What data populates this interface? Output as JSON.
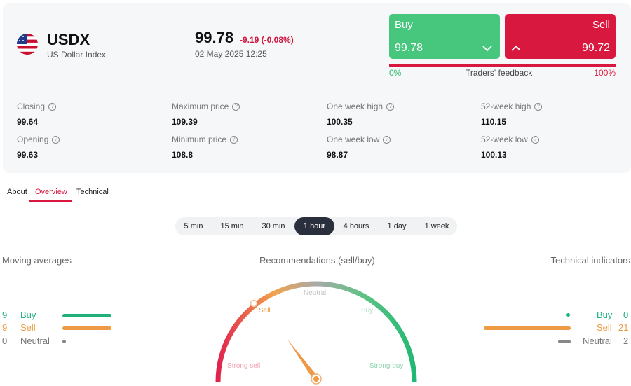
{
  "instrument": {
    "symbol": "USDX",
    "name": "US Dollar Index",
    "price": "99.78",
    "change": "-9.19 (-0.08%)",
    "datetime": "02 May 2025 12:25"
  },
  "trade": {
    "buy_label": "Buy",
    "buy_price": "99.78",
    "sell_label": "Sell",
    "sell_price": "99.72",
    "feedback_label": "Traders' feedback",
    "feedback_min": "0%",
    "feedback_max": "100%",
    "buy_share": 0.0
  },
  "stats": [
    {
      "label": "Closing",
      "value": "99.64"
    },
    {
      "label": "Maximum price",
      "value": "109.39"
    },
    {
      "label": "One week high",
      "value": "100.35"
    },
    {
      "label": "52-week high",
      "value": "110.15"
    },
    {
      "label": "Opening",
      "value": "99.63"
    },
    {
      "label": "Minimum price",
      "value": "108.8"
    },
    {
      "label": "One week low",
      "value": "98.87"
    },
    {
      "label": "52-week low",
      "value": "100.13"
    }
  ],
  "tabs": [
    {
      "label": "About"
    },
    {
      "label": "Overview",
      "active": true
    },
    {
      "label": "Technical"
    }
  ],
  "intervals": [
    {
      "label": "5 min"
    },
    {
      "label": "15 min"
    },
    {
      "label": "30 min"
    },
    {
      "label": "1 hour",
      "active": true
    },
    {
      "label": "4 hours"
    },
    {
      "label": "1 day"
    },
    {
      "label": "1 week"
    }
  ],
  "sections": {
    "moving_averages": "Moving averages",
    "recommendations": "Recommendations (sell/buy)",
    "technical_indicators": "Technical indicators"
  },
  "moving_averages": [
    {
      "count": "9",
      "label": "Buy",
      "share": 1.0
    },
    {
      "count": "9",
      "label": "Sell",
      "share": 1.0
    },
    {
      "count": "0",
      "label": "Neutral",
      "share": 0.0
    }
  ],
  "technical_indicators": [
    {
      "count": "0",
      "label": "Buy",
      "share": 0.0
    },
    {
      "count": "21",
      "label": "Sell",
      "share": 1.0
    },
    {
      "count": "2",
      "label": "Neutral",
      "share": 0.16
    }
  ],
  "gauge": {
    "labels": {
      "strong_sell": "Strong sell",
      "sell": "Sell",
      "neutral": "Neutral",
      "buy": "Buy",
      "strong_buy": "Strong buy"
    },
    "active": "Sell",
    "needle_value": 0.3
  },
  "colors": {
    "buy": "#47c67d",
    "sell": "#d9183f",
    "ma_buy": "#1fb07c",
    "ma_sell": "#ee9a45",
    "neutral": "#888888"
  },
  "icons": [
    "us-flag-icon",
    "chevron-down-icon",
    "chevron-up-icon",
    "help-icon"
  ]
}
